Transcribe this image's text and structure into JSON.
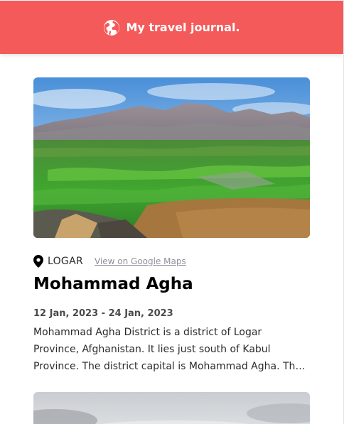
{
  "header": {
    "title": "My travel journal.",
    "icon": "globe-icon",
    "color": "#F55A5A"
  },
  "entries": [
    {
      "location": "LOGAR",
      "map_link_label": "View on Google Maps",
      "title": "Mohammad Agha",
      "dates": "12 Jan, 2023 - 24 Jan, 2023",
      "description": "Mohammad Agha District is a district of Logar Province, Afghanistan. It lies just south of Kabul Province. The district capital is Mohammad Agha. The district is home to mountains and green valleys.",
      "image": "mountain-valley-photo"
    },
    {
      "image": "cloudy-landscape-photo"
    }
  ]
}
